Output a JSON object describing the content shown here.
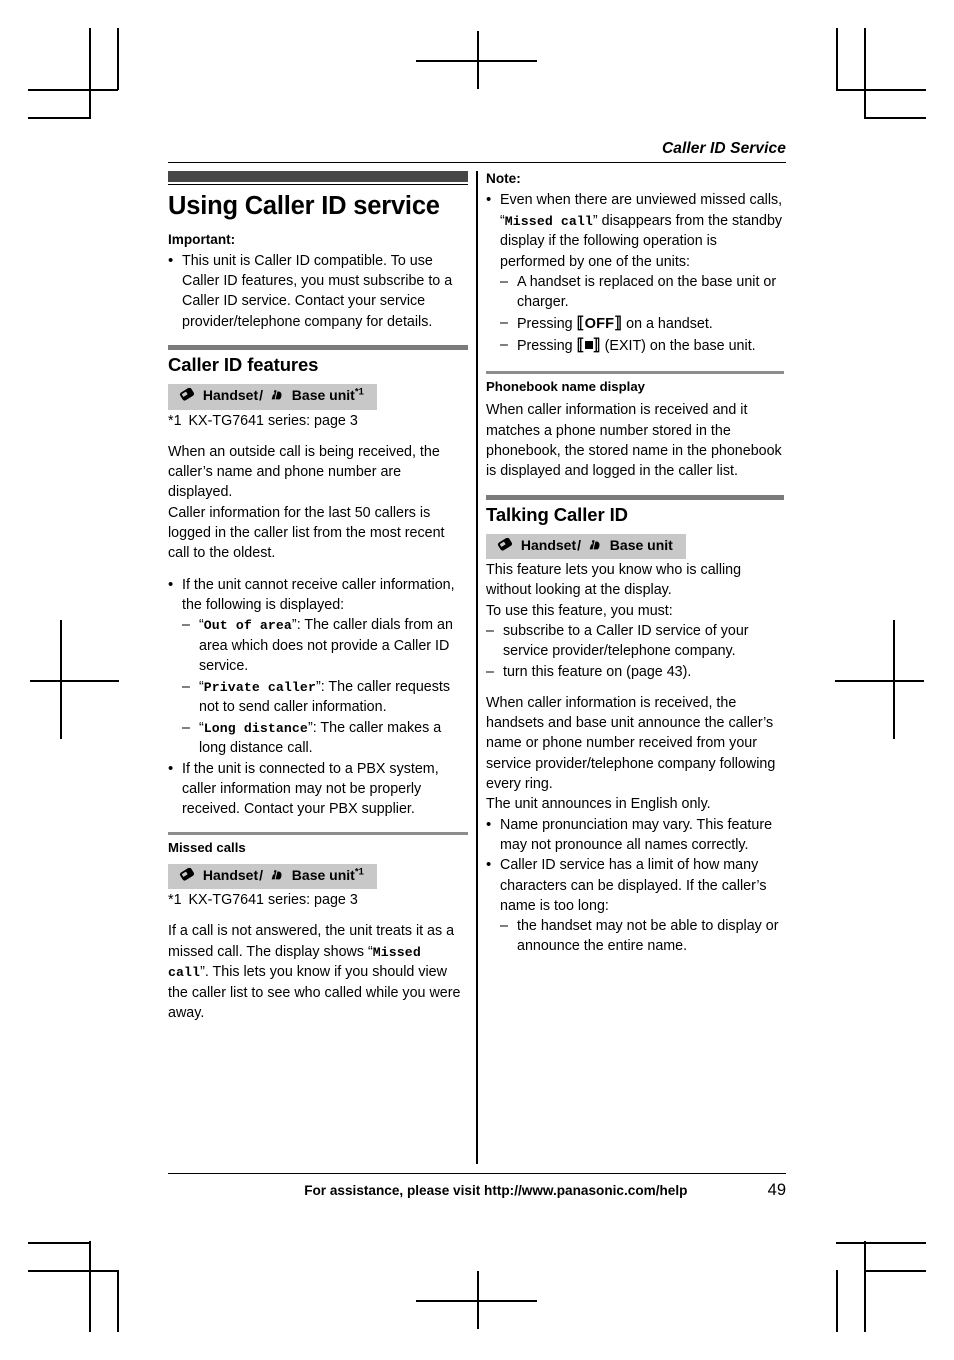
{
  "header": {
    "running_title": "Caller ID Service"
  },
  "left_column": {
    "chapter_title": "Using Caller ID service",
    "important_label": "Important:",
    "important_bullets": [
      "This unit is Caller ID compatible. To use Caller ID features, you must subscribe to a Caller ID service. Contact your service provider/telephone company for details."
    ],
    "section1": {
      "title": "Caller ID features",
      "badge": {
        "handset_label": "Handset",
        "separator": "/",
        "base_label": "Base unit",
        "footnote_mark": "*1",
        "handset_icon": "handset-icon",
        "base_icon": "base-unit-icon"
      },
      "footnote": {
        "mark": "*1",
        "text": "KX-TG7641 series: page 3"
      },
      "paragraph1": "When an outside call is being received, the caller’s name and phone number are displayed.",
      "paragraph2": "Caller information for the last 50 callers is logged in the caller list from the most recent call to the oldest.",
      "bullet1_intro": "If the unit cannot receive caller information, the following is displayed:",
      "bullet1_sub": [
        {
          "code": "Out of area",
          "rest": ": The caller dials from an area which does not provide a Caller ID service."
        },
        {
          "code": "Private caller",
          "rest": ": The caller requests not to send caller information."
        },
        {
          "code": "Long distance",
          "rest": ": The caller makes a long distance call."
        }
      ],
      "bullet2": "If the unit is connected to a PBX system, caller information may not be properly received. Contact your PBX supplier."
    },
    "section2": {
      "title": "Missed calls",
      "badge": {
        "handset_label": "Handset",
        "separator": "/",
        "base_label": "Base unit",
        "footnote_mark": "*1",
        "handset_icon": "handset-icon",
        "base_icon": "base-unit-icon"
      },
      "footnote": {
        "mark": "*1",
        "text": "KX-TG7641 series: page 3"
      },
      "paragraph_pre": "If a call is not answered, the unit treats it as a missed call. The display shows ",
      "paragraph_code": "Missed call",
      "paragraph_post": ". This lets you know if you should view the caller list to see who called while you were away."
    }
  },
  "right_column": {
    "note_label": "Note:",
    "note_bullet_pre": "Even when there are unviewed missed calls, ",
    "note_bullet_code": "Missed call",
    "note_bullet_post": " disappears from the standby display if the following operation is performed by one of the units:",
    "note_sub": [
      {
        "text": "A handset is replaced on the base unit or charger."
      },
      {
        "pre": "Pressing ",
        "key": "OFF",
        "post": " on a handset."
      },
      {
        "pre": "Pressing ",
        "key": "■",
        "post": " (EXIT) on the base unit."
      }
    ],
    "section_phonebook": {
      "title": "Phonebook name display",
      "paragraph": "When caller information is received and it matches a phone number stored in the phonebook, the stored name in the phonebook is displayed and logged in the caller list."
    },
    "section_talking": {
      "title": "Talking Caller ID",
      "badge": {
        "handset_label": "Handset",
        "separator": "/",
        "base_label": "Base unit",
        "handset_icon": "handset-icon",
        "base_icon": "base-unit-icon"
      },
      "paragraph1": "This feature lets you know who is calling without looking at the display.",
      "paragraph2": "To use this feature, you must:",
      "dashes": [
        "subscribe to a Caller ID service of your service provider/telephone company.",
        "turn this feature on (page 43)."
      ],
      "paragraph3": "When caller information is received, the handsets and base unit announce the caller’s name or phone number received from your service provider/telephone company following every ring.",
      "paragraph4": "The unit announces in English only.",
      "bullets": [
        "Name pronunciation may vary. This feature may not pronounce all names correctly."
      ],
      "bullet_limit_intro": "Caller ID service has a limit of how many characters can be displayed. If the caller’s name is too long:",
      "bullet_limit_sub": [
        "the handset may not be able to display or announce the entire name."
      ]
    }
  },
  "footer": {
    "assistance_text": "For assistance, please visit http://www.panasonic.com/help",
    "page_number": "49"
  },
  "colors": {
    "chapter_bar": "#474747",
    "section_bar": "#7b7b7b",
    "subsection_bar": "#8d8d8d",
    "badge_background": "#c8c8c8",
    "text": "#000000",
    "page_background": "#ffffff"
  }
}
